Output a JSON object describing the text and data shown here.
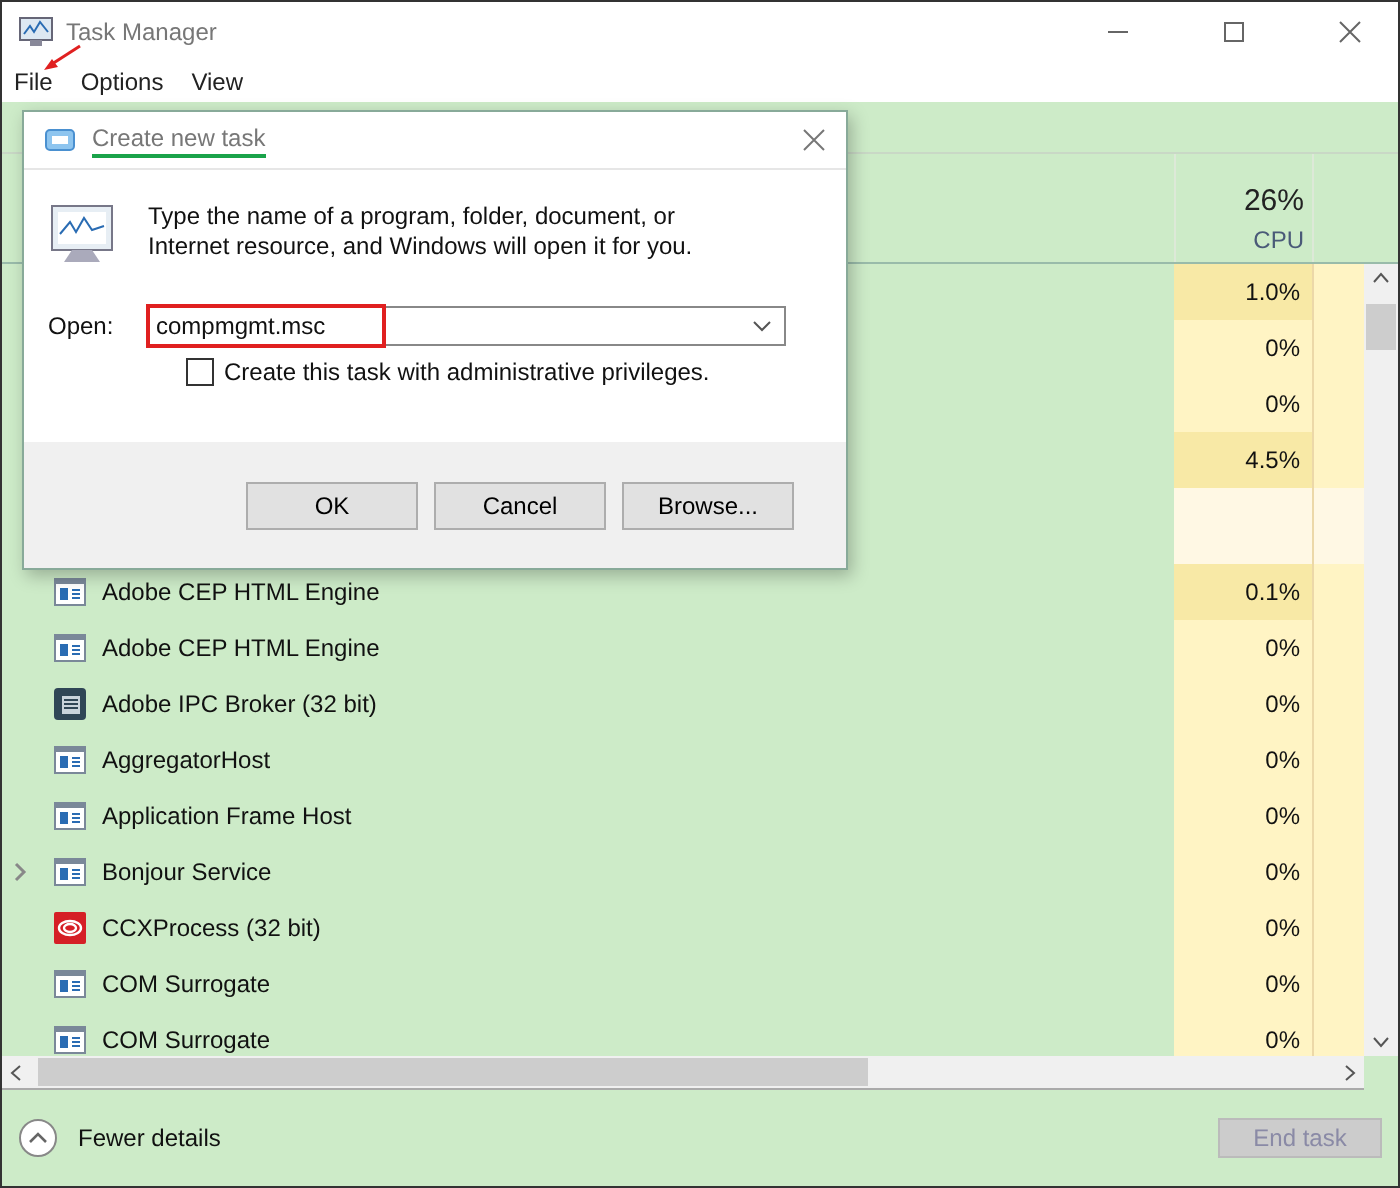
{
  "window": {
    "title": "Task Manager"
  },
  "menu": [
    {
      "label": "File",
      "annotated": true
    },
    {
      "label": "Options",
      "annotated": false
    },
    {
      "label": "View",
      "annotated": false
    }
  ],
  "header": {
    "cpu_total": "26%",
    "cpu_label": "CPU"
  },
  "rows": [
    {
      "kind": "covered",
      "cpu": "1.0%",
      "highlight": true
    },
    {
      "kind": "covered",
      "cpu": "0%",
      "highlight": false
    },
    {
      "kind": "covered",
      "cpu": "0%",
      "highlight": false
    },
    {
      "kind": "covered",
      "cpu": "4.5%",
      "highlight": true
    },
    {
      "kind": "group"
    },
    {
      "kind": "window",
      "name": "Adobe CEP HTML Engine",
      "cpu": "0.1%",
      "highlight": true,
      "expandable": false
    },
    {
      "kind": "window",
      "name": "Adobe CEP HTML Engine",
      "cpu": "0%",
      "highlight": false,
      "expandable": false
    },
    {
      "kind": "ipc",
      "name": "Adobe IPC Broker (32 bit)",
      "cpu": "0%",
      "highlight": false,
      "expandable": false
    },
    {
      "kind": "window",
      "name": "AggregatorHost",
      "cpu": "0%",
      "highlight": false,
      "expandable": false
    },
    {
      "kind": "window",
      "name": "Application Frame Host",
      "cpu": "0%",
      "highlight": false,
      "expandable": false
    },
    {
      "kind": "window",
      "name": "Bonjour Service",
      "cpu": "0%",
      "highlight": false,
      "expandable": true
    },
    {
      "kind": "ccx",
      "name": "CCXProcess (32 bit)",
      "cpu": "0%",
      "highlight": false,
      "expandable": false
    },
    {
      "kind": "window",
      "name": "COM Surrogate",
      "cpu": "0%",
      "highlight": false,
      "expandable": false
    },
    {
      "kind": "window",
      "name": "COM Surrogate",
      "cpu": "0%",
      "highlight": false,
      "expandable": false
    }
  ],
  "footer": {
    "toggle": "Fewer details",
    "end_task": {
      "label": "End task",
      "disabled": true
    }
  },
  "dialog": {
    "title": "Create new task",
    "title_underlined": true,
    "message": "Type the name of a program, folder, document, or Internet resource, and Windows will open it for you.",
    "open_label": "Open:",
    "open_value": "compmgmt.msc",
    "value_boxed": true,
    "admin_label": "Create this task with administrative privileges.",
    "admin_checked": false,
    "buttons": [
      "OK",
      "Cancel",
      "Browse..."
    ]
  }
}
